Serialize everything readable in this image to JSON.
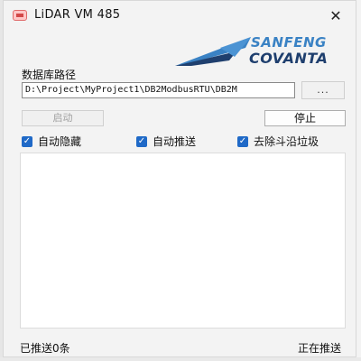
{
  "window": {
    "title": "LiDAR VM 485",
    "close_glyph": "✕"
  },
  "logo": {
    "line1": "SANFENG",
    "line2": "COVANTA",
    "colors": {
      "light": "#3a82c4",
      "dark": "#1f3f6e"
    }
  },
  "path": {
    "label": "数据库路径",
    "value": "D:\\Project\\MyProject1\\DB2ModbusRTU\\DB2M",
    "browse_label": "..."
  },
  "controls": {
    "start_label": "启动",
    "start_enabled": false,
    "stop_label": "停止"
  },
  "options": [
    {
      "label": "自动隐藏",
      "checked": true
    },
    {
      "label": "自动推送",
      "checked": true
    },
    {
      "label": "去除斗沿垃圾",
      "checked": true
    }
  ],
  "status": {
    "sent": "已推送0条",
    "state": "正在推送"
  },
  "accent": "#1f69c7"
}
